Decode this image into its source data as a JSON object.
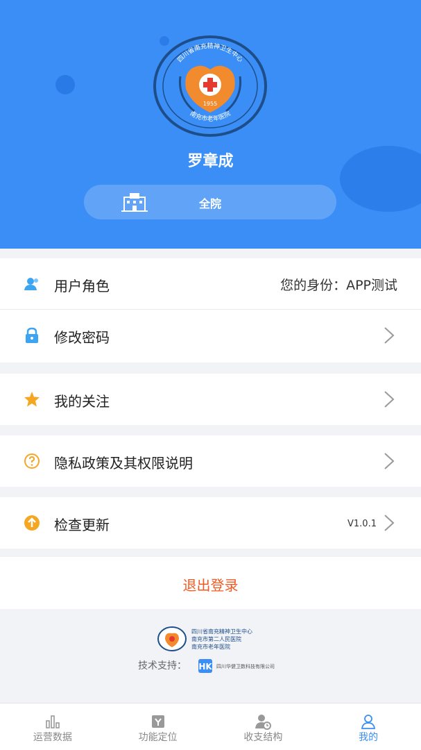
{
  "header": {
    "logo": {
      "ring_top_text": "四川省南充精神卫生中心",
      "ring_bottom_text": "南充市老年医院",
      "year": "1955"
    },
    "user_name": "罗章成",
    "department": "全院",
    "accent_color": "#3a8ef6"
  },
  "menu": {
    "user_role": {
      "label": "用户角色",
      "value": "您的身份：APP测试",
      "icon": "user-group-icon"
    },
    "change_password": {
      "label": "修改密码",
      "icon": "lock-icon"
    },
    "my_follow": {
      "label": "我的关注",
      "icon": "star-icon"
    },
    "privacy": {
      "label": "隐私政策及其权限说明",
      "icon": "question-circle-icon"
    },
    "check_update": {
      "label": "检查更新",
      "version": "V1.0.1",
      "icon": "upload-arrow-icon"
    }
  },
  "logout": {
    "label": "退出登录",
    "color": "#f05a22"
  },
  "footer": {
    "org_lines": [
      "四川省南充精神卫生中心",
      "南充市第二人民医院",
      "南充市老年医院"
    ],
    "tech_support_label": "技术支持：",
    "tech_company": "四川华健卫数科技有限公司"
  },
  "tabbar": {
    "tabs": [
      {
        "label": "运营数据",
        "icon": "bar-chart-icon",
        "active": false
      },
      {
        "label": "功能定位",
        "icon": "document-icon",
        "active": false
      },
      {
        "label": "收支结构",
        "icon": "user-clock-icon",
        "active": false
      },
      {
        "label": "我的",
        "icon": "person-icon",
        "active": true
      }
    ]
  }
}
